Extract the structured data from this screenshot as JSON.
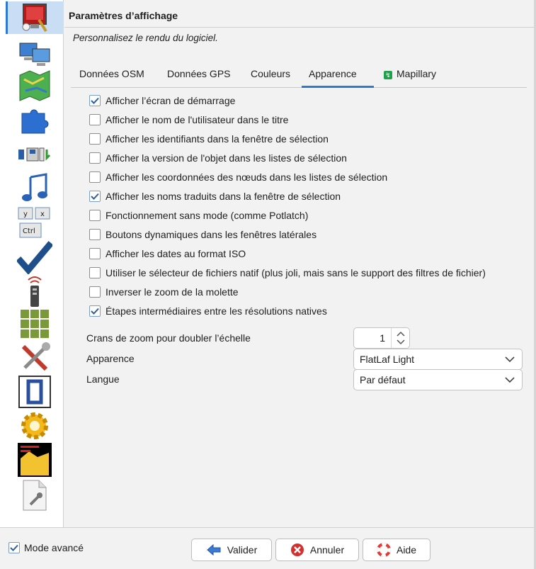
{
  "header": {
    "title": "Paramètres d’affichage",
    "subtitle": "Personnalisez le rendu du logiciel."
  },
  "sidebar": {
    "icons": [
      "display-settings-icon",
      "network-computers-icon",
      "map-icon",
      "plugin-puzzle-icon",
      "toolbar-icon",
      "audio-note-icon",
      "keyboard-shortcuts-icon",
      "validation-check-icon",
      "remote-control-icon",
      "grid-tiles-icon",
      "tools-icon",
      "frame-icon",
      "gear-icon",
      "code-console-icon",
      "advanced-file-icon"
    ]
  },
  "tabs": [
    {
      "label": "Données OSM",
      "active": false
    },
    {
      "label": "Données GPS",
      "active": false
    },
    {
      "label": "Couleurs",
      "active": false
    },
    {
      "label": "Apparence",
      "active": true
    },
    {
      "label": "Mapillary",
      "active": false
    }
  ],
  "checkboxes": [
    {
      "label": "Afficher l’écran de démarrage",
      "checked": true
    },
    {
      "label": "Afficher le nom de l'utilisateur dans le titre",
      "checked": false
    },
    {
      "label": "Afficher les identifiants dans la fenêtre de sélection",
      "checked": false
    },
    {
      "label": "Afficher la version de l'objet dans les listes de sélection",
      "checked": false
    },
    {
      "label": "Afficher les coordonnées des nœuds dans les listes de sélection",
      "checked": false
    },
    {
      "label": "Afficher les noms traduits dans la fenêtre de sélection",
      "checked": true
    },
    {
      "label": "Fonctionnement sans mode (comme Potlatch)",
      "checked": false
    },
    {
      "label": "Boutons dynamiques dans les fenêtres latérales",
      "checked": false
    },
    {
      "label": "Afficher les dates au format ISO",
      "checked": false
    },
    {
      "label": "Utiliser le sélecteur de fichiers natif (plus joli, mais sans le support des filtres de fichier)",
      "checked": false
    },
    {
      "label": "Inverser le zoom de la molette",
      "checked": false
    },
    {
      "label": "Étapes intermédiaires entre les résolutions natives",
      "checked": true
    }
  ],
  "form": {
    "zoom_label": "Crans de zoom pour doubler l’échelle",
    "zoom_value": "1",
    "appearance_label": "Apparence",
    "appearance_value": "FlatLaf Light",
    "language_label": "Langue",
    "language_value": "Par défaut"
  },
  "footer": {
    "advanced_mode_label": "Mode avancé",
    "advanced_mode_checked": true,
    "ok_label": "Valider",
    "cancel_label": "Annuler",
    "help_label": "Aide"
  },
  "colors": {
    "accent": "#2e79d6",
    "checkmark": "#2b5f9e"
  }
}
